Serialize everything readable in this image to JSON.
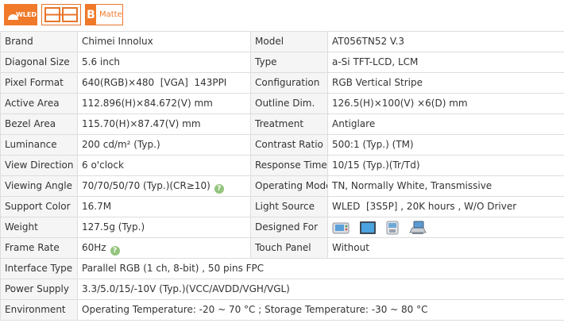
{
  "badges": {
    "wled": "WLED",
    "matte": "Matte",
    "matte_mark": "B"
  },
  "specs": {
    "brand": {
      "label": "Brand",
      "value": "Chimei Innolux"
    },
    "model": {
      "label": "Model",
      "value": "AT056TN52 V.3"
    },
    "diagonal": {
      "label": "Diagonal Size",
      "value": "5.6 inch"
    },
    "type": {
      "label": "Type",
      "value": "a-Si TFT-LCD, LCM"
    },
    "pixel_format": {
      "label": "Pixel Format",
      "value": "640(RGB)×480  [VGA]  143PPI"
    },
    "configuration": {
      "label": "Configuration",
      "value": "RGB Vertical Stripe"
    },
    "active_area": {
      "label": "Active Area",
      "value": "112.896(H)×84.672(V) mm"
    },
    "outline": {
      "label": "Outline Dim.",
      "value": "126.5(H)×100(V) ×6(D) mm"
    },
    "bezel": {
      "label": "Bezel Area",
      "value": "115.70(H)×87.47(V) mm"
    },
    "treatment": {
      "label": "Treatment",
      "value": "Antiglare"
    },
    "luminance": {
      "label": "Luminance",
      "value": "200 cd/m² (Typ.)"
    },
    "contrast": {
      "label": "Contrast Ratio",
      "value": "500:1 (Typ.) (TM)"
    },
    "view_direction": {
      "label": "View Direction",
      "value": "6 o'clock"
    },
    "response": {
      "label": "Response Time",
      "value": "10/15 (Typ.)(Tr/Td)"
    },
    "viewing_angle": {
      "label": "Viewing Angle",
      "value": "70/70/50/70 (Typ.)(CR≥10)"
    },
    "operating_mode": {
      "label": "Operating Mode",
      "value": "TN, Normally White, Transmissive"
    },
    "support_color": {
      "label": "Support Color",
      "value": "16.7M"
    },
    "light_source": {
      "label": "Light Source",
      "value": "WLED  [3S5P] , 20K hours , W/O Driver"
    },
    "weight": {
      "label": "Weight",
      "value": "127.5g (Typ.)"
    },
    "designed_for": {
      "label": "Designed For"
    },
    "frame_rate": {
      "label": "Frame Rate",
      "value": "60Hz"
    },
    "touch_panel": {
      "label": "Touch Panel",
      "value": "Without"
    },
    "interface": {
      "label": "Interface Type",
      "value": "Parallel RGB (1 ch, 8-bit) , 50 pins FPC"
    },
    "power": {
      "label": "Power Supply",
      "value": "3.3/5.0/15/-10V (Typ.)(VCC/AVDD/VGH/VGL)"
    },
    "environment": {
      "label": "Environment",
      "value": "Operating Temperature: -20 ~ 70 °C ; Storage Temperature: -30 ~ 80 °C"
    }
  },
  "help_icon": "?",
  "colors": {
    "accent": "#f07a2a",
    "help": "#93c47d",
    "label_bg": "#f5f5f5",
    "border": "#dddddd"
  }
}
